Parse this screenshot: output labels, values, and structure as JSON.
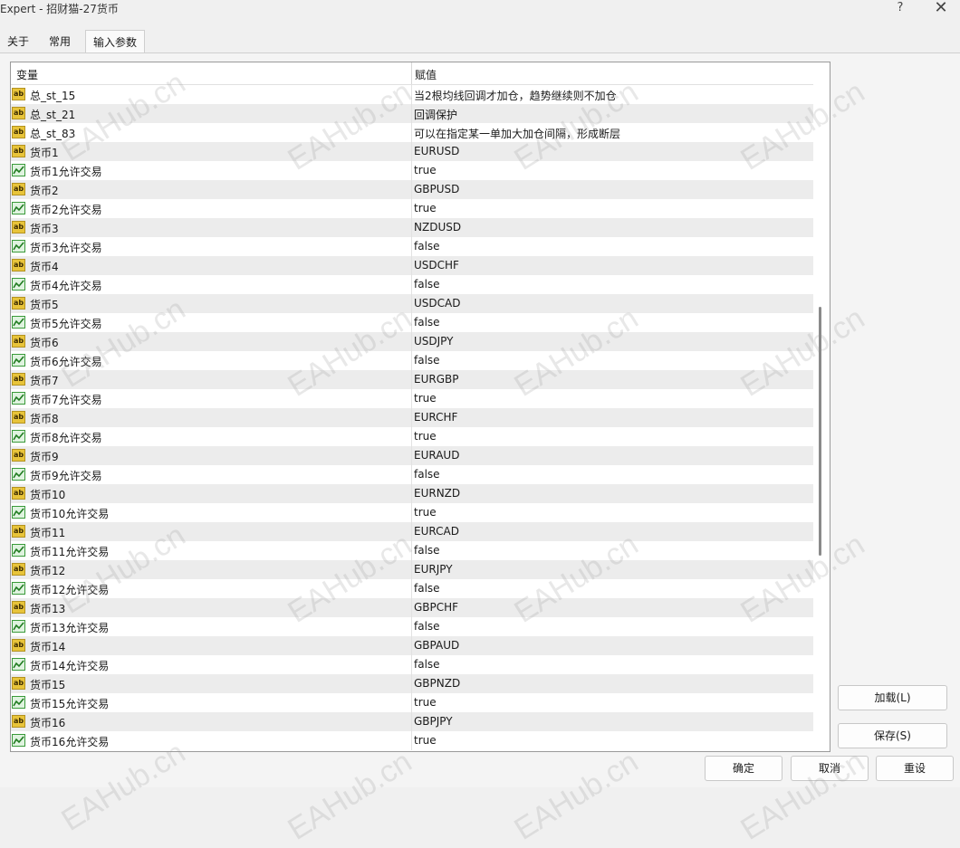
{
  "window": {
    "title": "Expert - 招财猫-27货币",
    "help_label": "?",
    "close_label": "✕"
  },
  "tabs": [
    {
      "label": "关于"
    },
    {
      "label": "常用"
    },
    {
      "label": "输入参数",
      "active": true
    }
  ],
  "table": {
    "col_variable": "变量",
    "col_value": "赋值",
    "rows": [
      {
        "icon": "ab-string-icon",
        "name": "总_st_15",
        "value": "当2根均线回调才加仓，趋势继续则不加仓"
      },
      {
        "icon": "ab-string-icon",
        "name": "总_st_21",
        "value": "回调保护"
      },
      {
        "icon": "ab-string-icon",
        "name": "总_st_83",
        "value": "可以在指定某一单加大加仓间隔，形成断层"
      },
      {
        "icon": "ab-string-icon",
        "name": "货币1",
        "value": "EURUSD"
      },
      {
        "icon": "bool-chart-icon",
        "name": "货币1允许交易",
        "value": "true"
      },
      {
        "icon": "ab-string-icon",
        "name": "货币2",
        "value": "GBPUSD"
      },
      {
        "icon": "bool-chart-icon",
        "name": "货币2允许交易",
        "value": "true"
      },
      {
        "icon": "ab-string-icon",
        "name": "货币3",
        "value": "NZDUSD"
      },
      {
        "icon": "bool-chart-icon",
        "name": "货币3允许交易",
        "value": "false"
      },
      {
        "icon": "ab-string-icon",
        "name": "货币4",
        "value": "USDCHF"
      },
      {
        "icon": "bool-chart-icon",
        "name": "货币4允许交易",
        "value": "false"
      },
      {
        "icon": "ab-string-icon",
        "name": "货币5",
        "value": "USDCAD"
      },
      {
        "icon": "bool-chart-icon",
        "name": "货币5允许交易",
        "value": "false"
      },
      {
        "icon": "ab-string-icon",
        "name": "货币6",
        "value": "USDJPY"
      },
      {
        "icon": "bool-chart-icon",
        "name": "货币6允许交易",
        "value": "false"
      },
      {
        "icon": "ab-string-icon",
        "name": "货币7",
        "value": "EURGBP"
      },
      {
        "icon": "bool-chart-icon",
        "name": "货币7允许交易",
        "value": "true"
      },
      {
        "icon": "ab-string-icon",
        "name": "货币8",
        "value": "EURCHF"
      },
      {
        "icon": "bool-chart-icon",
        "name": "货币8允许交易",
        "value": "true"
      },
      {
        "icon": "ab-string-icon",
        "name": "货币9",
        "value": "EURAUD"
      },
      {
        "icon": "bool-chart-icon",
        "name": "货币9允许交易",
        "value": "false"
      },
      {
        "icon": "ab-string-icon",
        "name": "货币10",
        "value": "EURNZD"
      },
      {
        "icon": "bool-chart-icon",
        "name": "货币10允许交易",
        "value": "true"
      },
      {
        "icon": "ab-string-icon",
        "name": "货币11",
        "value": "EURCAD"
      },
      {
        "icon": "bool-chart-icon",
        "name": "货币11允许交易",
        "value": "false"
      },
      {
        "icon": "ab-string-icon",
        "name": "货币12",
        "value": "EURJPY"
      },
      {
        "icon": "bool-chart-icon",
        "name": "货币12允许交易",
        "value": "false"
      },
      {
        "icon": "ab-string-icon",
        "name": "货币13",
        "value": "GBPCHF"
      },
      {
        "icon": "bool-chart-icon",
        "name": "货币13允许交易",
        "value": "false"
      },
      {
        "icon": "ab-string-icon",
        "name": "货币14",
        "value": "GBPAUD"
      },
      {
        "icon": "bool-chart-icon",
        "name": "货币14允许交易",
        "value": "false"
      },
      {
        "icon": "ab-string-icon",
        "name": "货币15",
        "value": "GBPNZD"
      },
      {
        "icon": "bool-chart-icon",
        "name": "货币15允许交易",
        "value": "true"
      },
      {
        "icon": "ab-string-icon",
        "name": "货币16",
        "value": "GBPJPY"
      },
      {
        "icon": "bool-chart-icon",
        "name": "货币16允许交易",
        "value": "true"
      }
    ]
  },
  "buttons": {
    "load": "加载(L)",
    "save": "保存(S)",
    "ok": "确定",
    "cancel": "取消",
    "reset": "重设"
  },
  "watermark": "EAHub.cn"
}
